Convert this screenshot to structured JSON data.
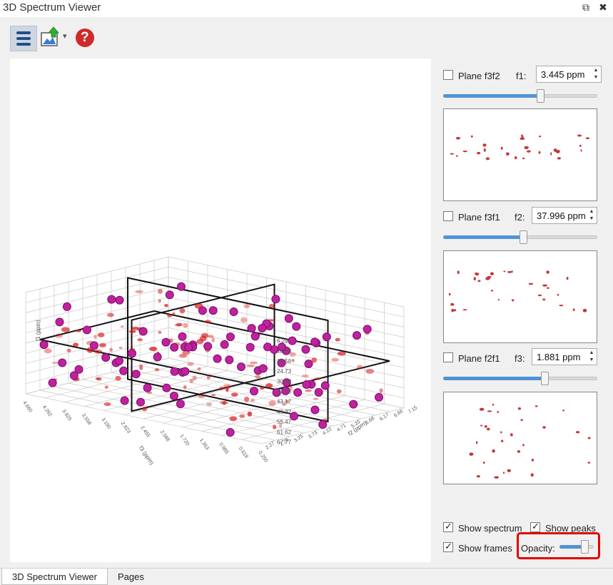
{
  "window": {
    "title": "3D Spectrum Viewer",
    "restore_glyph": "⧉",
    "close_glyph": "✖"
  },
  "toolbar": {
    "buttons": [
      {
        "name": "menu",
        "icon": "hamburger-menu-icon"
      },
      {
        "name": "export",
        "icon": "export-image-icon",
        "dropdown": "▾"
      },
      {
        "name": "help",
        "icon": "help-icon",
        "glyph": "?"
      }
    ]
  },
  "plot": {
    "z_ticks": [
      "6.29",
      "12.43",
      "18.58",
      "24.73",
      "30.88",
      "37.03",
      "43.17",
      "49.32",
      "55.47",
      "61.62",
      "67.77"
    ],
    "x_ticks": [
      "4.660",
      "4.292",
      "3.925",
      "3.558",
      "3.190",
      "2.823",
      "2.455",
      "2.088",
      "1.720",
      "1.353",
      "0.985",
      "0.618",
      "0.250"
    ],
    "y_ticks": [
      "2.27",
      "2.76",
      "3.25",
      "3.73",
      "4.22",
      "4.71",
      "5.20",
      "5.68",
      "6.17",
      "6.66",
      "7.15"
    ],
    "z_axis_label": "f1 (ppm)",
    "x_axis_label": "f3 (ppm)",
    "y_axis_label": "f2 (ppm)"
  },
  "planes": [
    {
      "key": "f3f2",
      "label": "Plane f3f2",
      "checked": false,
      "param_label": "f1:",
      "value": "3.445 ppm",
      "slider": 0.64
    },
    {
      "key": "f3f1",
      "label": "Plane f3f1",
      "checked": false,
      "param_label": "f2:",
      "value": "37.996 ppm",
      "slider": 0.52
    },
    {
      "key": "f2f1",
      "label": "Plane f2f1",
      "checked": false,
      "param_label": "f3:",
      "value": "1.881 ppm",
      "slider": 0.67
    }
  ],
  "options": {
    "show_spectrum": {
      "label": "Show spectrum",
      "checked": true
    },
    "show_peaks": {
      "label": "Show peaks",
      "checked": true
    },
    "show_frames": {
      "label": "Show frames",
      "checked": true
    },
    "opacity": {
      "label": "Opacity:",
      "value": 0.8
    }
  },
  "tabs": [
    {
      "label": "3D Spectrum Viewer",
      "active": true
    },
    {
      "label": "Pages",
      "active": false
    }
  ],
  "colors": {
    "accent": "#4f93d6",
    "highlight": "#e00000",
    "peak": "#c0219e",
    "spectrum": "#d41414"
  }
}
